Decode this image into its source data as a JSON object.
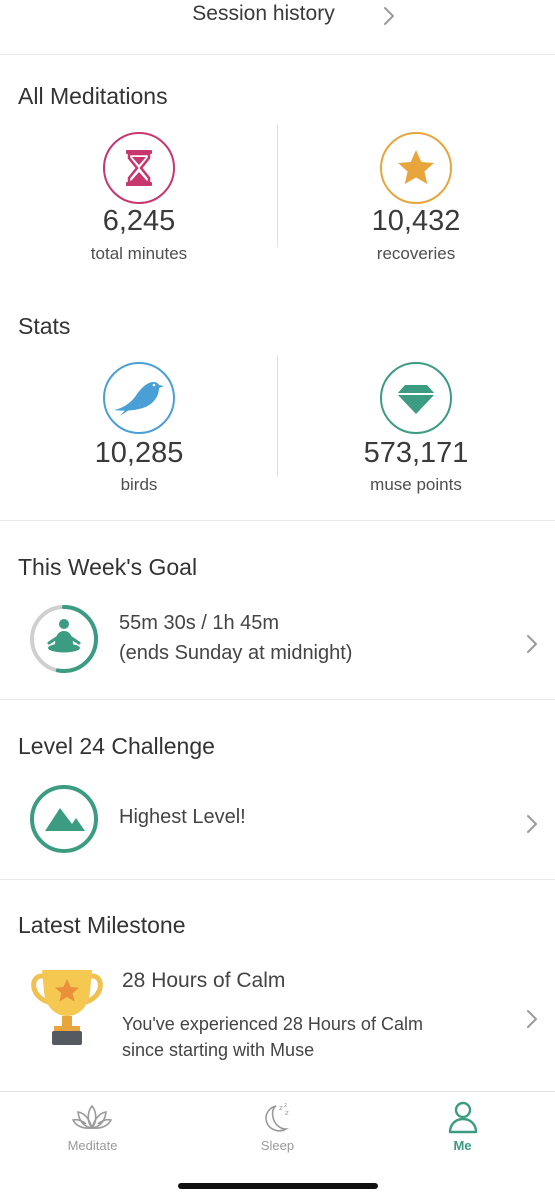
{
  "header": {
    "title": "Session history"
  },
  "all_meditations": {
    "title": "All Meditations",
    "stats": [
      {
        "value": "6,245",
        "label": "total minutes",
        "icon": "hourglass-icon",
        "color": "#c8366e"
      },
      {
        "value": "10,432",
        "label": "recoveries",
        "icon": "star-icon",
        "color": "#e7a53c"
      }
    ]
  },
  "stats": {
    "title": "Stats",
    "stats": [
      {
        "value": "10,285",
        "label": "birds",
        "icon": "bird-icon",
        "color": "#4a9fd6"
      },
      {
        "value": "573,171",
        "label": "muse points",
        "icon": "gem-icon",
        "color": "#3b9c82"
      }
    ]
  },
  "weekly_goal": {
    "title": "This Week's Goal",
    "progress_text": "55m 30s / 1h 45m",
    "ends_text": "(ends Sunday at midnight)",
    "progress": 0.53,
    "color": "#3b9c82"
  },
  "challenge": {
    "title": "Level 24 Challenge",
    "status": "Highest Level!",
    "color": "#3b9c82"
  },
  "milestone": {
    "title": "Latest Milestone",
    "name": "28 Hours of Calm",
    "description_line1": "You've experienced 28 Hours of Calm",
    "description_line2": "since starting with Muse"
  },
  "tab_bar": {
    "active_color": "#3b9c82",
    "inactive_color": "#9a9a9a",
    "tabs": [
      {
        "label": "Meditate",
        "icon": "lotus-icon"
      },
      {
        "label": "Sleep",
        "icon": "moon-icon"
      },
      {
        "label": "Me",
        "icon": "person-icon"
      }
    ]
  }
}
